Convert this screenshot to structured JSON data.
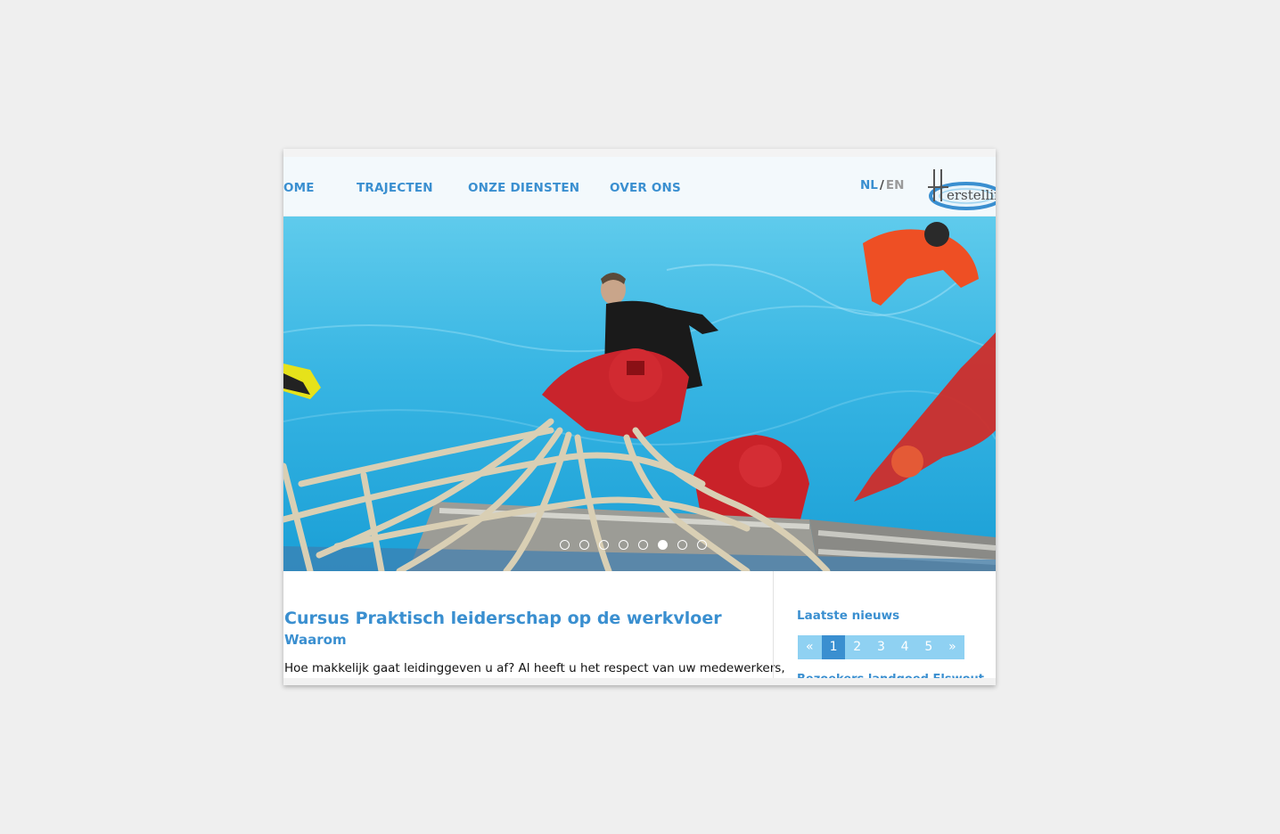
{
  "nav": {
    "items": [
      {
        "label": "OME"
      },
      {
        "label": "TRAJECTEN"
      },
      {
        "label": "ONZE DIENSTEN"
      },
      {
        "label": "OVER ONS"
      }
    ]
  },
  "lang": {
    "nl": "NL",
    "separator": "/",
    "en": "EN"
  },
  "logo": {
    "text": "erstellin"
  },
  "slider": {
    "slide_count": 8,
    "active_index": 5
  },
  "article": {
    "title": "Cursus Praktisch leiderschap op de werkvloer",
    "subtitle": "Waarom",
    "body": "Hoe makkelijk gaat leidinggeven u af? Al heeft u het respect van uw medewerkers,"
  },
  "sidebar": {
    "heading": "Laatste nieuws",
    "pager": {
      "prev": "«",
      "pages": [
        "1",
        "2",
        "3",
        "4",
        "5"
      ],
      "next": "»",
      "active": "1"
    },
    "first_news": "Bezoekers landgoed Elswout"
  },
  "colors": {
    "accent": "#3a8fd0",
    "pager_light": "#8fd1f2",
    "nav_bg": "#f3f9fc"
  }
}
